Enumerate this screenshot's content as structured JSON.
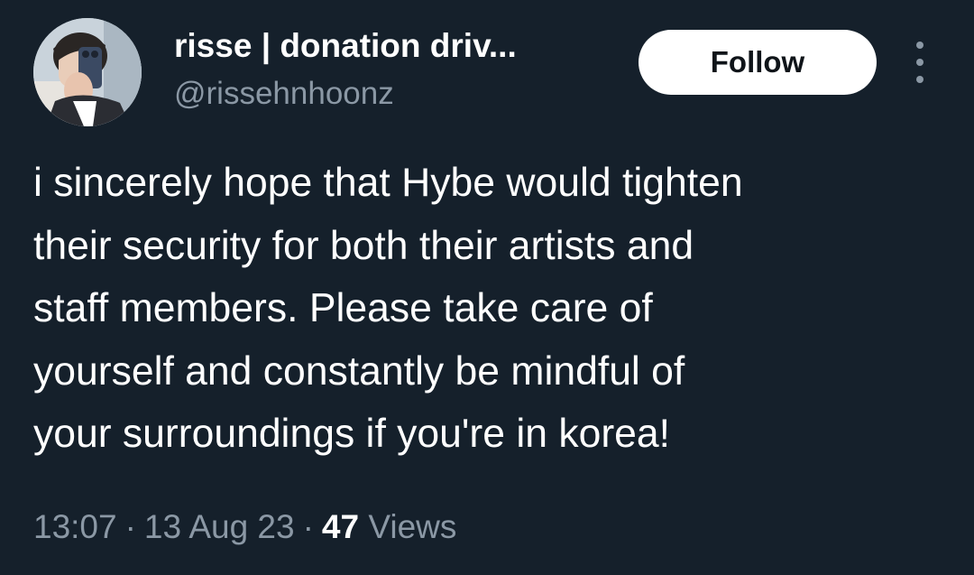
{
  "author": {
    "display_name": "risse | donation driv...",
    "handle": "@rissehnhoonz",
    "avatar_icon": "profile-photo-mirror-selfie"
  },
  "actions": {
    "follow_label": "Follow",
    "more_icon": "more-vertical-icon"
  },
  "tweet": {
    "lines": [
      "i sincerely hope that Hybe would tighten",
      "their security for both their artists and",
      "staff members. Please take care of",
      "yourself and constantly be mindful of",
      "your surroundings if you're in korea!"
    ]
  },
  "meta": {
    "time": "13:07",
    "separator": "·",
    "date": "13 Aug 23",
    "views_count": "47",
    "views_label": "Views"
  },
  "colors": {
    "background": "#15202b",
    "text_primary": "#ffffff",
    "text_secondary": "#8b98a5",
    "button_bg": "#ffffff",
    "button_text": "#0f1419"
  }
}
